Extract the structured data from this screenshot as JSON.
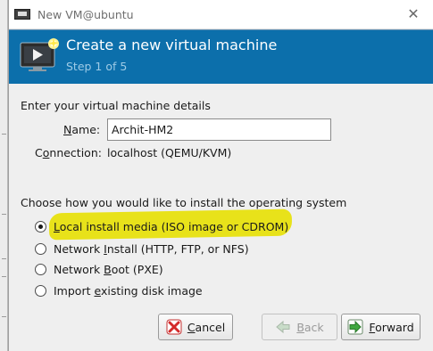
{
  "window": {
    "title": "New VM@ubuntu",
    "close_glyph": "✕"
  },
  "header": {
    "title": "Create a new virtual machine",
    "step": "Step 1 of 5",
    "background": "#0c6fab"
  },
  "details": {
    "heading": "Enter your virtual machine details",
    "name_label": "Name:",
    "name_value": "Archit-HM2",
    "connection_label": "Connection:",
    "connection_value": "localhost (QEMU/KVM)"
  },
  "install": {
    "heading": "Choose how you would like to install the operating system",
    "options": [
      {
        "label": "Local install media (ISO image or CDROM)",
        "selected": true,
        "highlighted": true
      },
      {
        "label": "Network Install (HTTP, FTP, or NFS)",
        "selected": false
      },
      {
        "label": "Network Boot (PXE)",
        "selected": false
      },
      {
        "label": "Import existing disk image",
        "selected": false
      }
    ],
    "highlight_color": "#e8e21a"
  },
  "buttons": {
    "cancel": {
      "label": "Cancel",
      "icon": "red-x-icon"
    },
    "back": {
      "label": "Back",
      "icon": "back-arrow-icon",
      "enabled": false
    },
    "forward": {
      "label": "Forward",
      "icon": "forward-arrow-icon"
    }
  }
}
